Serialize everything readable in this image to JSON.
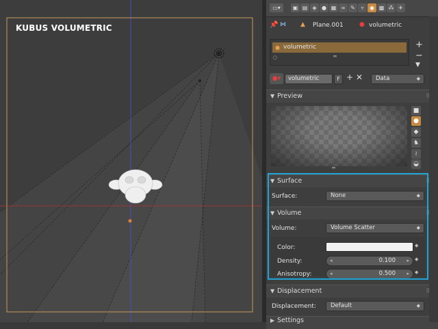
{
  "viewport": {
    "title": "KUBUS VOLUMETRIC"
  },
  "header": {
    "editor_menu_icon": "properties-editor-icon",
    "context_tabs": [
      "render-icon",
      "render-layers-icon",
      "scene-icon",
      "world-icon",
      "object-icon",
      "constraints-icon",
      "modifiers-icon",
      "data-icon",
      "material-icon",
      "texture-icon",
      "particles-icon",
      "physics-icon"
    ],
    "active_tab": "material-icon"
  },
  "breadcrumb": {
    "object": "Plane.001",
    "material": "volumetric"
  },
  "material_slots": {
    "items": [
      "volumetric"
    ],
    "selected": "volumetric"
  },
  "datablock": {
    "name": "volumetric",
    "fake_user": "F",
    "link_mode": "Data"
  },
  "preview": {
    "title": "Preview"
  },
  "surface": {
    "title": "Surface",
    "label": "Surface:",
    "value": "None"
  },
  "volume": {
    "title": "Volume",
    "label": "Volume:",
    "value": "Volume Scatter",
    "color_label": "Color:",
    "color_value": "#f2f2f2",
    "density_label": "Density:",
    "density_value": "0.100",
    "anisotropy_label": "Anisotropy:",
    "anisotropy_value": "0.500"
  },
  "displacement": {
    "title": "Displacement",
    "label": "Displacement:",
    "value": "Default"
  },
  "settings": {
    "title": "Settings"
  },
  "colors": {
    "highlight_box": "#1ea5d6",
    "selected_slot": "#8a6a3a",
    "camera_frame": "#c89a5a"
  }
}
